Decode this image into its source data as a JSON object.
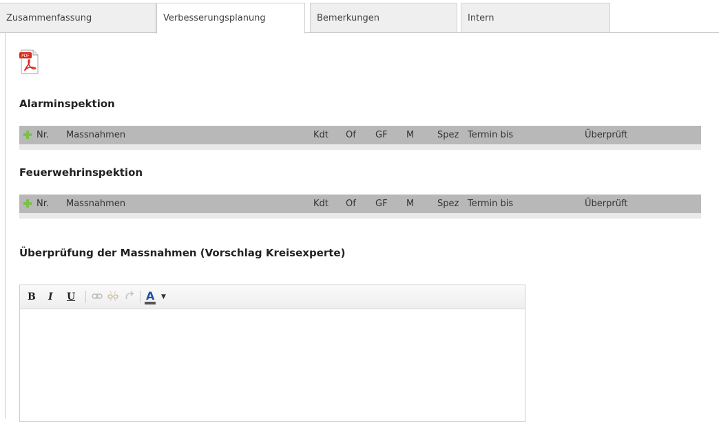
{
  "tabs": [
    {
      "label": "Zusammenfassung",
      "active": false
    },
    {
      "label": "Verbesserungsplanung",
      "active": true
    },
    {
      "label": "Bemerkungen",
      "active": false
    },
    {
      "label": "Intern",
      "active": false
    }
  ],
  "pdf_icon": {
    "name": "pdf-icon",
    "badge": "PDF"
  },
  "sections": {
    "alarm": {
      "title": "Alarminspektion",
      "columns": [
        "Nr.",
        "Massnahmen",
        "Kdt",
        "Of",
        "GF",
        "M",
        "Spez",
        "Termin bis",
        "Überprüft"
      ]
    },
    "feuerwehr": {
      "title": "Feuerwehrinspektion",
      "columns": [
        "Nr.",
        "Massnahmen",
        "Kdt",
        "Of",
        "GF",
        "M",
        "Spez",
        "Termin bis",
        "Überprüft"
      ]
    },
    "review": {
      "title": "Überprüfung der Massnahmen (Vorschlag Kreisexperte)"
    }
  },
  "editor": {
    "bold": "B",
    "italic": "I",
    "underline": "U",
    "font_color_label": "A",
    "content": ""
  },
  "colors": {
    "header_bg": "#b8b8b8",
    "add_icon": "#7cc04b",
    "pdf_red": "#d9261c",
    "font_color_underline": "#1f4fa0"
  }
}
